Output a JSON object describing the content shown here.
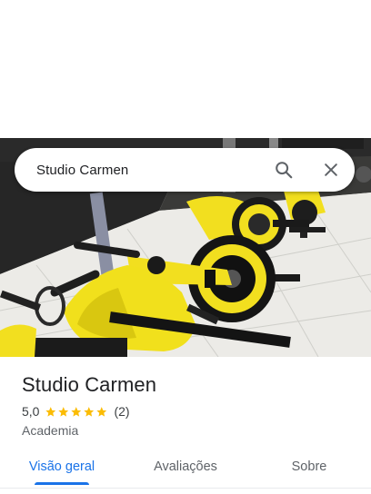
{
  "search": {
    "query": "Studio Carmen"
  },
  "place": {
    "name": "Studio Carmen",
    "rating": "5,0",
    "rating_stars": 5,
    "review_count": "(2)",
    "category": "Academia"
  },
  "tabs": [
    {
      "label": "Visão geral",
      "active": true
    },
    {
      "label": "Avaliações",
      "active": false
    },
    {
      "label": "Sobre",
      "active": false
    }
  ],
  "colors": {
    "accent": "#1a73e8",
    "star": "#fbbc04",
    "bike_yellow": "#f2df1f"
  },
  "icons": {
    "search": "search-icon",
    "close": "close-icon",
    "star": "star-icon"
  }
}
